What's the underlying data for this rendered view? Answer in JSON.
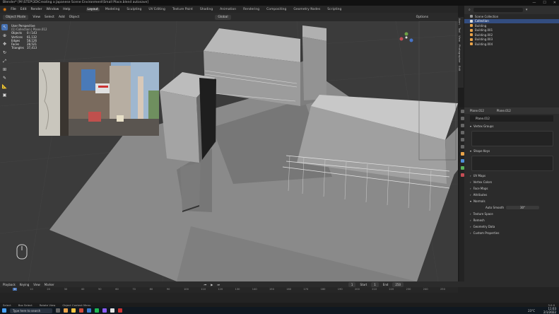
{
  "window": {
    "title": "Blender* [M:\\STEP\\3D\\Creating a Japanese Scene Environment\\Small Place.blend autosave]",
    "controls": [
      "—",
      "☐",
      "✕"
    ]
  },
  "menu": {
    "items": [
      "File",
      "Edit",
      "Render",
      "Window",
      "Help"
    ],
    "workspaces": [
      "Layout",
      "Modeling",
      "Sculpting",
      "UV Editing",
      "Texture Paint",
      "Shading",
      "Animation",
      "Rendering",
      "Compositing",
      "Geometry Nodes",
      "Scripting"
    ],
    "active_workspace": "Layout"
  },
  "viewport_header": {
    "mode": "Object Mode",
    "menus": [
      "View",
      "Select",
      "Add",
      "Object"
    ],
    "orientation": "Global",
    "options": "Options"
  },
  "stats": {
    "title": "User Perspective",
    "subtitle": "(1) Collection | Plane.012",
    "rows": [
      {
        "k": "Objects",
        "v": "0 / 143"
      },
      {
        "k": "Vertices",
        "v": "61,132"
      },
      {
        "k": "Edges",
        "v": "58,126"
      },
      {
        "k": "Faces",
        "v": "28,521"
      },
      {
        "k": "Triangles",
        "v": "37,413"
      }
    ]
  },
  "overlay_toggle": "Concentrat Layer",
  "n_panel_tabs": [
    "Item",
    "Tool",
    "View",
    "Photographer",
    "Edit"
  ],
  "outliner": {
    "header": "Scene Collection",
    "rows": [
      {
        "label": "Scene Collection",
        "selected": false
      },
      {
        "label": "Collection",
        "selected": true
      },
      {
        "label": "Building",
        "selected": false
      },
      {
        "label": "Building.001",
        "selected": false
      },
      {
        "label": "Building.002",
        "selected": false
      },
      {
        "label": "Building.003",
        "selected": false
      },
      {
        "label": "Building.004",
        "selected": false
      }
    ]
  },
  "properties": {
    "object_name": "Plane.012",
    "data_name": "Plane.012",
    "sections": [
      "Vertex Groups",
      "Shape Keys",
      "UV Maps",
      "Vertex Colors",
      "Face Maps",
      "Attributes",
      "Normals",
      "Texture Space",
      "Remesh",
      "Geometry Data",
      "Custom Properties"
    ],
    "auto_smooth_label": "Auto Smooth",
    "auto_smooth_value": "30°"
  },
  "timeline": {
    "menus": [
      "Playback",
      "Keying",
      "View",
      "Marker"
    ],
    "current_frame": "1",
    "start_label": "Start",
    "start": "1",
    "end_label": "End",
    "end": "250",
    "ticks": [
      "0",
      "10",
      "20",
      "30",
      "40",
      "50",
      "60",
      "70",
      "80",
      "90",
      "100",
      "110",
      "120",
      "130",
      "140",
      "150",
      "160",
      "170",
      "180",
      "190",
      "200",
      "210",
      "220",
      "230",
      "240",
      "250"
    ]
  },
  "statusbar": {
    "items": [
      "Select",
      "Box Select",
      "Rotate View",
      "Object Context Menu"
    ],
    "version": "3.0.0"
  },
  "taskbar": {
    "search_placeholder": "Type here to search",
    "clock_time": "11:03",
    "clock_date": "2/1/2022",
    "temp": "23°C"
  }
}
